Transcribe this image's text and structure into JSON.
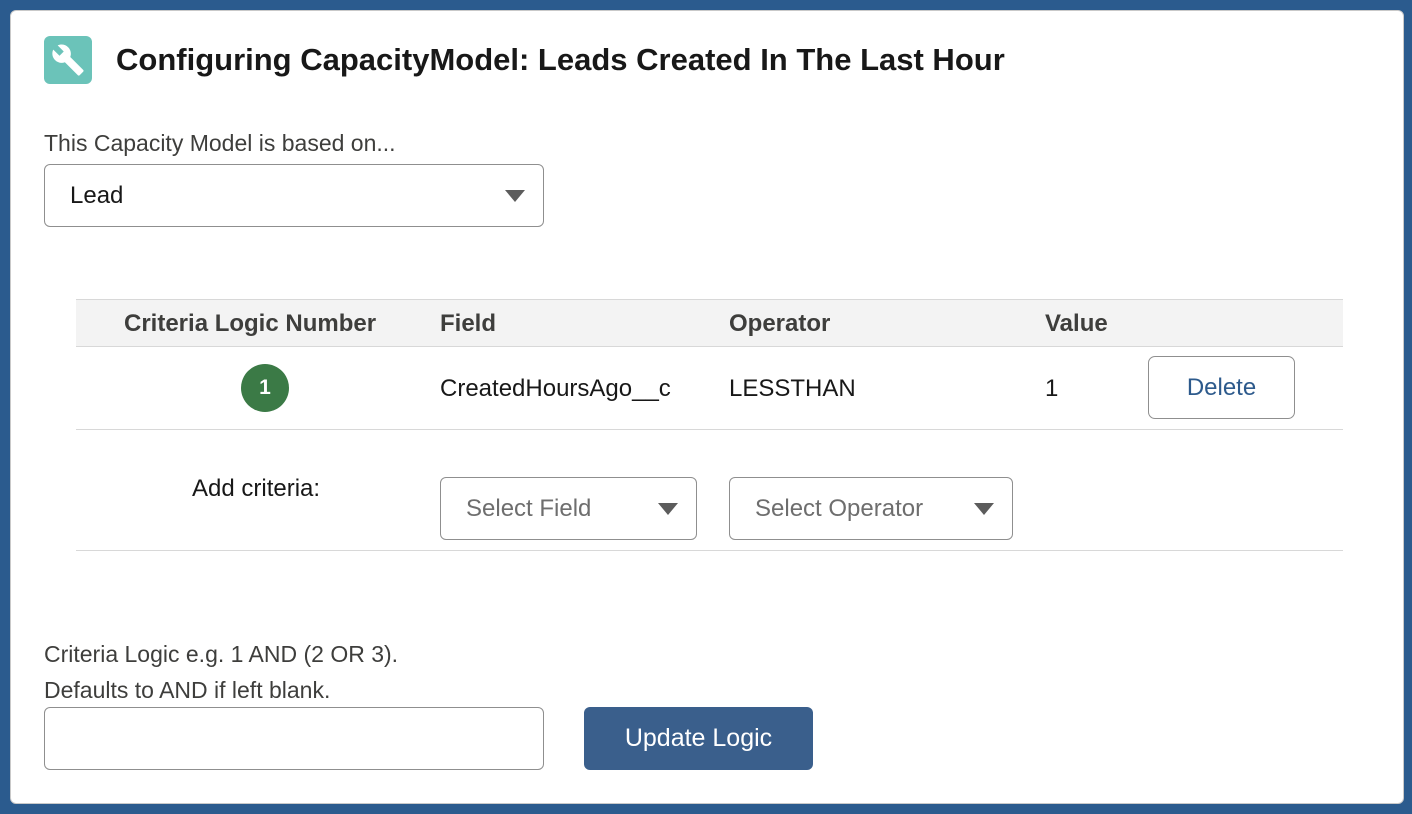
{
  "header": {
    "title": "Configuring CapacityModel: Leads Created In The Last Hour",
    "icon": "wrench-icon",
    "icon_color": "#6bc3b9"
  },
  "object_selector": {
    "label": "This Capacity Model is based on...",
    "value": "Lead"
  },
  "criteria_table": {
    "columns": [
      "Criteria Logic Number",
      "Field",
      "Operator",
      "Value"
    ],
    "rows": [
      {
        "number": "1",
        "field": "CreatedHoursAgo__c",
        "operator": "LESSTHAN",
        "value": "1",
        "delete_label": "Delete"
      }
    ],
    "badge_color": "#3b7a46"
  },
  "add_criteria": {
    "label": "Add criteria:",
    "field_placeholder": "Select Field",
    "operator_placeholder": "Select Operator"
  },
  "logic": {
    "help_line1": "Criteria Logic e.g. 1 AND (2 OR 3).",
    "help_line2": "Defaults to AND if left blank.",
    "input_value": "",
    "update_label": "Update Logic",
    "button_color": "#3a5f8c"
  }
}
